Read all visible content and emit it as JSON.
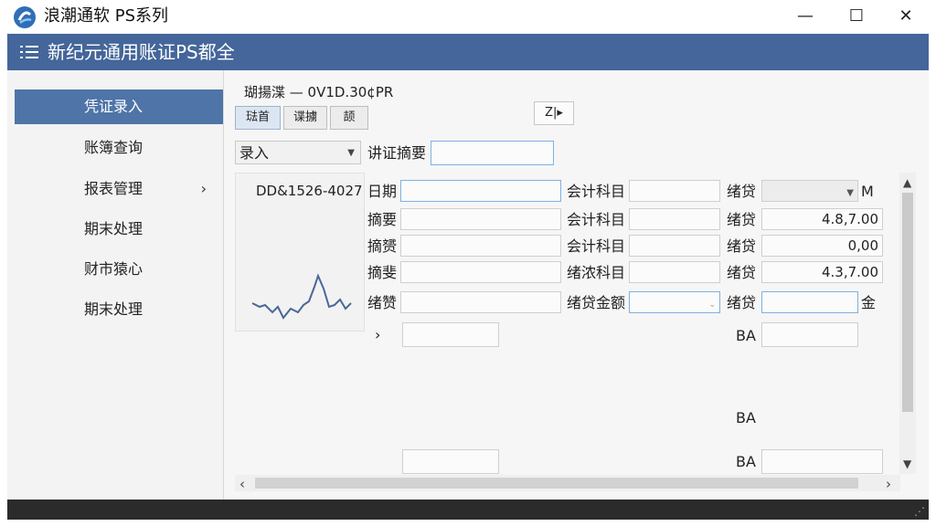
{
  "window": {
    "title": "浪潮通软 PS系列",
    "minimize": "—",
    "maximize": "☐",
    "close": "✕"
  },
  "header": {
    "title": "新纪元通用账证PS都全"
  },
  "sidebar": {
    "items": [
      {
        "label": "凭证录入",
        "active": true
      },
      {
        "label": "账簿查询"
      },
      {
        "label": "报表管理",
        "arrow": "›"
      },
      {
        "label": "期末处理"
      },
      {
        "label": "财市猿心"
      },
      {
        "label": "期末处理"
      }
    ]
  },
  "main": {
    "sub_title": "瑚揚渫  — 0V1D.30¢PR",
    "tabs": [
      "琺首",
      "谍擄",
      "颉"
    ],
    "mini_button": "Z|▸",
    "mode_select": "录入",
    "summary_label": "讲证摘要",
    "summary_value": "",
    "doc_id": "DD&1526-4027",
    "rows": [
      {
        "label": "日期",
        "account_label": "会计科目",
        "dc_label": "绪贷",
        "amount": "",
        "suffix": "M",
        "has_dropdown": true
      },
      {
        "label": "摘要",
        "account_label": "会计科目",
        "dc_label": "绪贷",
        "amount": "4.8,7.00"
      },
      {
        "label": "摘赟",
        "account_label": "会计科目",
        "dc_label": "绪贷",
        "amount": "0,00"
      },
      {
        "label": "摘斐",
        "account_label": "绪浓科目",
        "dc_label": "绪贷",
        "amount": "4.3,7.00"
      },
      {
        "label": "绪赞",
        "account_label": "绪贷金额",
        "dc_label": "绪贷",
        "amount": "",
        "suffix": "金",
        "has_dropdown": true
      }
    ],
    "expand_arrow": "›",
    "ba_labels": [
      "BA",
      "BA",
      "BA"
    ]
  },
  "scroll": {
    "up": "▲",
    "down": "▼",
    "left": "‹",
    "right": "›"
  },
  "status": {
    "grip": "⋰"
  },
  "colors": {
    "header_bg": "#44669a",
    "active_item": "#4e74a8",
    "status_bg": "#2b2b2b"
  }
}
